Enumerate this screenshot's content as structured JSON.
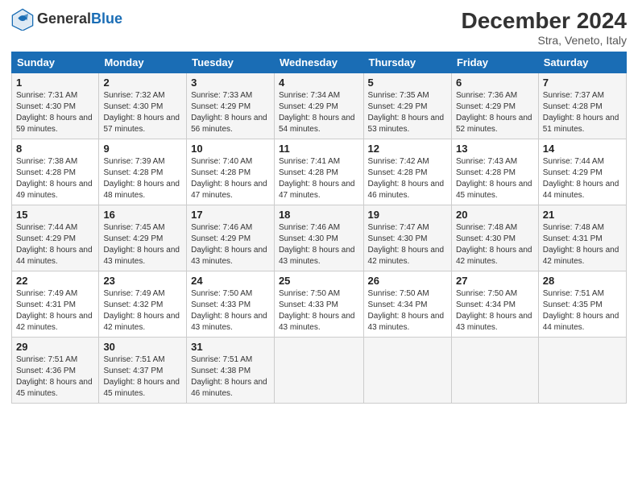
{
  "header": {
    "logo_text_general": "General",
    "logo_text_blue": "Blue",
    "main_title": "December 2024",
    "subtitle": "Stra, Veneto, Italy"
  },
  "calendar": {
    "days_of_week": [
      "Sunday",
      "Monday",
      "Tuesday",
      "Wednesday",
      "Thursday",
      "Friday",
      "Saturday"
    ],
    "weeks": [
      [
        null,
        null,
        null,
        null,
        null,
        null,
        null
      ]
    ],
    "cells": [
      [
        {
          "day": "1",
          "sunrise": "7:31 AM",
          "sunset": "4:30 PM",
          "daylight": "8 hours and 59 minutes."
        },
        {
          "day": "2",
          "sunrise": "7:32 AM",
          "sunset": "4:30 PM",
          "daylight": "8 hours and 57 minutes."
        },
        {
          "day": "3",
          "sunrise": "7:33 AM",
          "sunset": "4:29 PM",
          "daylight": "8 hours and 56 minutes."
        },
        {
          "day": "4",
          "sunrise": "7:34 AM",
          "sunset": "4:29 PM",
          "daylight": "8 hours and 54 minutes."
        },
        {
          "day": "5",
          "sunrise": "7:35 AM",
          "sunset": "4:29 PM",
          "daylight": "8 hours and 53 minutes."
        },
        {
          "day": "6",
          "sunrise": "7:36 AM",
          "sunset": "4:29 PM",
          "daylight": "8 hours and 52 minutes."
        },
        {
          "day": "7",
          "sunrise": "7:37 AM",
          "sunset": "4:28 PM",
          "daylight": "8 hours and 51 minutes."
        }
      ],
      [
        {
          "day": "8",
          "sunrise": "7:38 AM",
          "sunset": "4:28 PM",
          "daylight": "8 hours and 49 minutes."
        },
        {
          "day": "9",
          "sunrise": "7:39 AM",
          "sunset": "4:28 PM",
          "daylight": "8 hours and 48 minutes."
        },
        {
          "day": "10",
          "sunrise": "7:40 AM",
          "sunset": "4:28 PM",
          "daylight": "8 hours and 47 minutes."
        },
        {
          "day": "11",
          "sunrise": "7:41 AM",
          "sunset": "4:28 PM",
          "daylight": "8 hours and 47 minutes."
        },
        {
          "day": "12",
          "sunrise": "7:42 AM",
          "sunset": "4:28 PM",
          "daylight": "8 hours and 46 minutes."
        },
        {
          "day": "13",
          "sunrise": "7:43 AM",
          "sunset": "4:28 PM",
          "daylight": "8 hours and 45 minutes."
        },
        {
          "day": "14",
          "sunrise": "7:44 AM",
          "sunset": "4:29 PM",
          "daylight": "8 hours and 44 minutes."
        }
      ],
      [
        {
          "day": "15",
          "sunrise": "7:44 AM",
          "sunset": "4:29 PM",
          "daylight": "8 hours and 44 minutes."
        },
        {
          "day": "16",
          "sunrise": "7:45 AM",
          "sunset": "4:29 PM",
          "daylight": "8 hours and 43 minutes."
        },
        {
          "day": "17",
          "sunrise": "7:46 AM",
          "sunset": "4:29 PM",
          "daylight": "8 hours and 43 minutes."
        },
        {
          "day": "18",
          "sunrise": "7:46 AM",
          "sunset": "4:30 PM",
          "daylight": "8 hours and 43 minutes."
        },
        {
          "day": "19",
          "sunrise": "7:47 AM",
          "sunset": "4:30 PM",
          "daylight": "8 hours and 42 minutes."
        },
        {
          "day": "20",
          "sunrise": "7:48 AM",
          "sunset": "4:30 PM",
          "daylight": "8 hours and 42 minutes."
        },
        {
          "day": "21",
          "sunrise": "7:48 AM",
          "sunset": "4:31 PM",
          "daylight": "8 hours and 42 minutes."
        }
      ],
      [
        {
          "day": "22",
          "sunrise": "7:49 AM",
          "sunset": "4:31 PM",
          "daylight": "8 hours and 42 minutes."
        },
        {
          "day": "23",
          "sunrise": "7:49 AM",
          "sunset": "4:32 PM",
          "daylight": "8 hours and 42 minutes."
        },
        {
          "day": "24",
          "sunrise": "7:50 AM",
          "sunset": "4:33 PM",
          "daylight": "8 hours and 43 minutes."
        },
        {
          "day": "25",
          "sunrise": "7:50 AM",
          "sunset": "4:33 PM",
          "daylight": "8 hours and 43 minutes."
        },
        {
          "day": "26",
          "sunrise": "7:50 AM",
          "sunset": "4:34 PM",
          "daylight": "8 hours and 43 minutes."
        },
        {
          "day": "27",
          "sunrise": "7:50 AM",
          "sunset": "4:34 PM",
          "daylight": "8 hours and 43 minutes."
        },
        {
          "day": "28",
          "sunrise": "7:51 AM",
          "sunset": "4:35 PM",
          "daylight": "8 hours and 44 minutes."
        }
      ],
      [
        {
          "day": "29",
          "sunrise": "7:51 AM",
          "sunset": "4:36 PM",
          "daylight": "8 hours and 45 minutes."
        },
        {
          "day": "30",
          "sunrise": "7:51 AM",
          "sunset": "4:37 PM",
          "daylight": "8 hours and 45 minutes."
        },
        {
          "day": "31",
          "sunrise": "7:51 AM",
          "sunset": "4:38 PM",
          "daylight": "8 hours and 46 minutes."
        },
        null,
        null,
        null,
        null
      ]
    ]
  }
}
